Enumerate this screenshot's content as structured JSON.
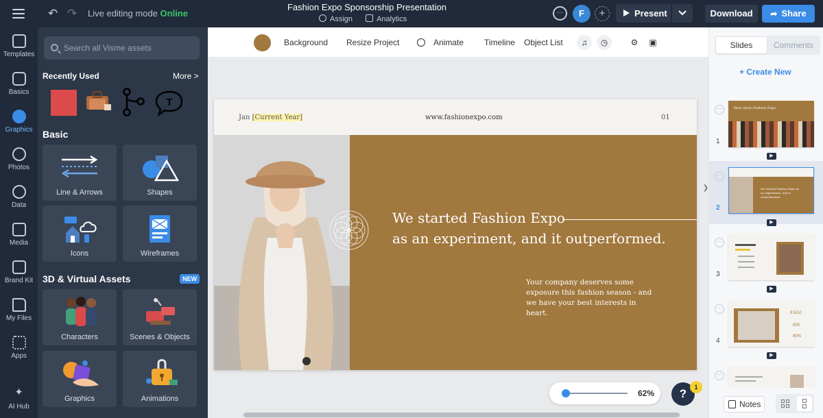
{
  "topbar": {
    "mode_label": "Live editing mode",
    "mode_status": "Online",
    "doc_title": "Fashion Expo Sponsorship Presentation",
    "assign_label": "Assign",
    "analytics_label": "Analytics",
    "avatar_initial": "F",
    "present_label": "Present",
    "download_label": "Download",
    "share_label": "Share"
  },
  "rail": [
    {
      "label": "Templates",
      "icon": "templates-icon"
    },
    {
      "label": "Basics",
      "icon": "basics-icon"
    },
    {
      "label": "Graphics",
      "icon": "graphics-icon"
    },
    {
      "label": "Photos",
      "icon": "photos-icon"
    },
    {
      "label": "Data",
      "icon": "data-icon"
    },
    {
      "label": "Media",
      "icon": "media-icon"
    },
    {
      "label": "Brand Kit",
      "icon": "brand-kit-icon"
    },
    {
      "label": "My Files",
      "icon": "folder-icon"
    },
    {
      "label": "Apps",
      "icon": "apps-icon"
    },
    {
      "label": "AI Hub",
      "icon": "ai-hub-icon"
    }
  ],
  "panel": {
    "search_placeholder": "Search all Visme assets",
    "recent_title": "Recently Used",
    "more_label": "More >",
    "basic_title": "Basic",
    "basic_tiles": [
      "Line & Arrows",
      "Shapes",
      "Icons",
      "Wireframes"
    ],
    "virtual_title": "3D & Virtual Assets",
    "new_badge": "NEW",
    "virtual_tiles": [
      "Characters",
      "Scenes & Objects",
      "Graphics",
      "Animations"
    ]
  },
  "toolbar": {
    "background_color": "#a1783e",
    "items": [
      "Background",
      "Resize Project",
      "Animate",
      "Timeline",
      "Object List"
    ]
  },
  "slide": {
    "date_prefix": "Jan",
    "date_highlight": "[Current Year]",
    "url": "www.fashionexpo.com",
    "page_number": "01",
    "headline_line1": "We started Fashion Expo",
    "headline_line2": "as an experiment, and it outperformed.",
    "body": "Your company deserves some exposure this fashion season - and we have your best interests in heart.",
    "accent_color": "#a1783e"
  },
  "zoom": {
    "percent": "62%",
    "level": 0.06
  },
  "help": {
    "label": "?",
    "badge": "1"
  },
  "rightpane": {
    "tabs": [
      "Slides",
      "Comments"
    ],
    "create_label": "+ Create New",
    "slide_numbers": [
      "1",
      "2",
      "3",
      "4"
    ],
    "selected_slide": "2",
    "thumb1_title": "New Style Fashion Expo",
    "thumb2_text": "We started Fashion Expo as an experiment, and it outperformed.",
    "thumb4_stats": [
      "9.5/10",
      "500",
      "80%"
    ],
    "notes_label": "Notes"
  }
}
